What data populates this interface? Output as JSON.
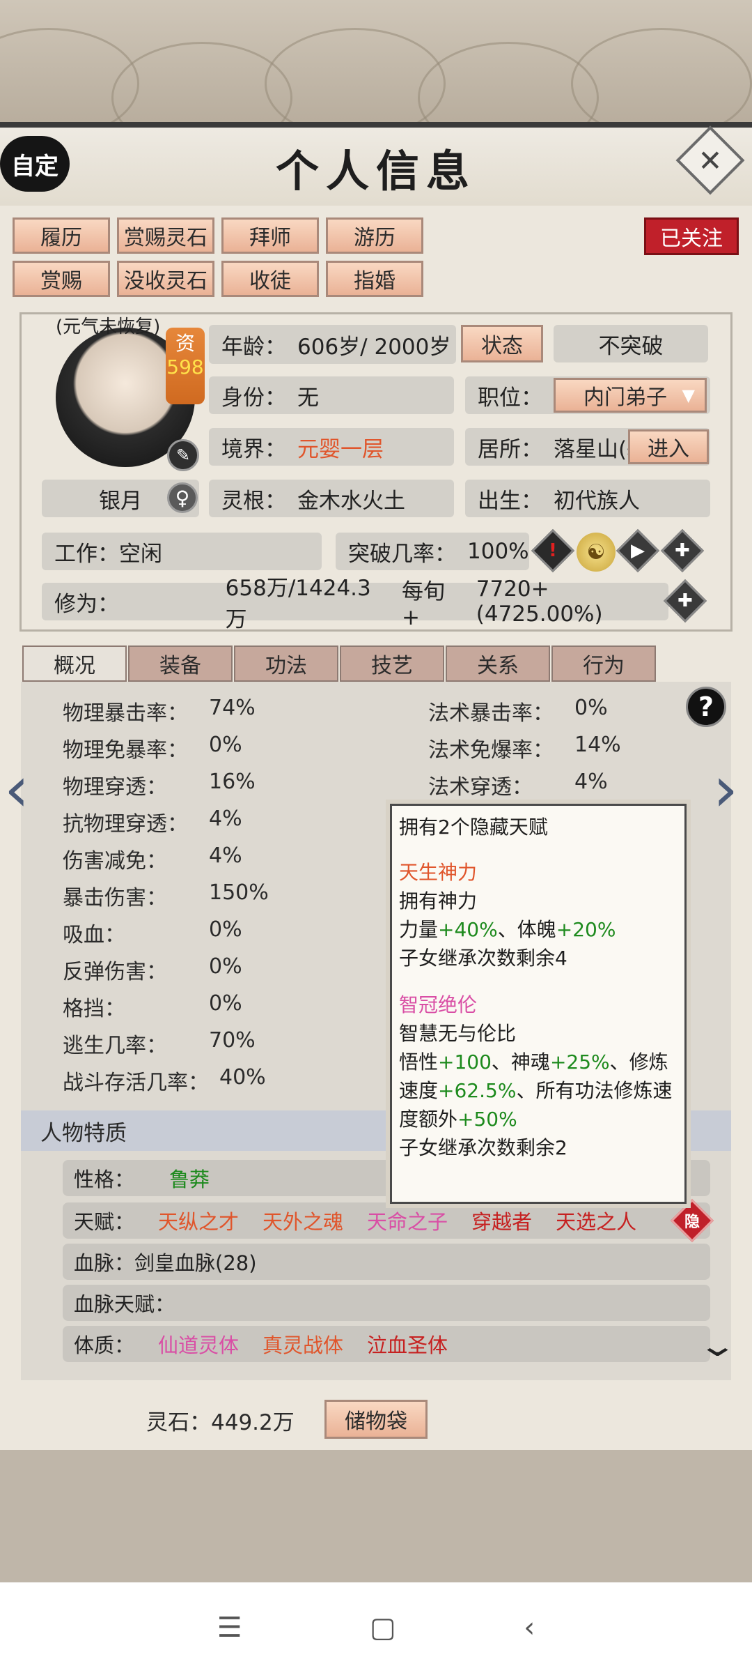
{
  "header": {
    "title": "个人信息",
    "auto_label": "自定",
    "close_icon": "close-icon"
  },
  "actions": {
    "row1": [
      "履历",
      "赏赐灵石",
      "拜师",
      "游历"
    ],
    "row2": [
      "赏赐",
      "没收灵石",
      "收徒",
      "指婚"
    ],
    "follow_badge": "已关注"
  },
  "profile": {
    "status_note": "(元气未恢复)",
    "aptitude_label": "资",
    "aptitude_value": "598",
    "name": "银月",
    "gender_icon": "female-icon",
    "age_label": "年龄：",
    "age_value": "606岁/ 2000岁",
    "state_button": "状态",
    "breakthrough_mode": "不突破",
    "identity_label": "身份：",
    "identity_value": "无",
    "position_label": "职位：",
    "position_value": "内门弟子",
    "realm_label": "境界：",
    "realm_value": "元婴一层",
    "residence_label": "居所：",
    "residence_value": "落星山(基",
    "enter_button": "进入",
    "root_label": "灵根：",
    "root_value": "金木水火土",
    "birth_label": "出生：",
    "birth_value": "初代族人",
    "work_label": "工作：",
    "work_value": "空闲",
    "breakthrough_label": "突破几率：",
    "breakthrough_value": "100%",
    "cultivation_label": "修为：",
    "cultivation_value": "658万/1424.3万",
    "per_turn_label": "每旬+",
    "per_turn_value": "7720+(4725.00%)"
  },
  "tabs": [
    "概况",
    "装备",
    "功法",
    "技艺",
    "关系",
    "行为"
  ],
  "stats_left": [
    {
      "label": "物理暴击率：",
      "value": "74%"
    },
    {
      "label": "物理免暴率：",
      "value": "0%"
    },
    {
      "label": "物理穿透：",
      "value": "16%"
    },
    {
      "label": "抗物理穿透：",
      "value": "4%"
    },
    {
      "label": "伤害减免：",
      "value": "4%"
    },
    {
      "label": "暴击伤害：",
      "value": "150%"
    },
    {
      "label": "吸血：",
      "value": "0%"
    },
    {
      "label": "反弹伤害：",
      "value": "0%"
    },
    {
      "label": "格挡：",
      "value": "0%"
    },
    {
      "label": "逃生几率：",
      "value": "70%"
    },
    {
      "label": "战斗存活几率：",
      "value": "40%"
    }
  ],
  "stats_right": [
    {
      "label": "法术暴击率：",
      "value": "0%"
    },
    {
      "label": "法术免爆率：",
      "value": "14%"
    },
    {
      "label": "法术穿透：",
      "value": "4%"
    }
  ],
  "traits": {
    "header": "人物特质",
    "personality_label": "性格：",
    "personality_value": "鲁莽",
    "talent_label": "天赋：",
    "talents": [
      "天纵之才",
      "天外之魂",
      "天命之子",
      "穿越者",
      "天选之人"
    ],
    "hidden_label": "隐",
    "bloodline_label": "血脉：",
    "bloodline_value": "剑皇血脉(28)",
    "bloodline_talent_label": "血脉天赋：",
    "physique_label": "体质：",
    "physiques": [
      "仙道灵体",
      "真灵战体",
      "泣血圣体"
    ]
  },
  "tooltip": {
    "title": "拥有2个隐藏天赋",
    "t1_name": "天生神力",
    "t1_desc": "拥有神力",
    "t1_l1a": "力量",
    "t1_l1b": "+40%",
    "t1_l1c": "、体魄",
    "t1_l1d": "+20%",
    "t1_inherit": "子女继承次数剩余4",
    "t2_name": "智冠绝伦",
    "t2_desc": "智慧无与伦比",
    "t2_a": "悟性",
    "t2_b": "+100",
    "t2_c": "、神魂",
    "t2_d": "+25%",
    "t2_e": "、修炼速度",
    "t2_f": "+62.5%",
    "t2_g": "、所有功法修炼速度额外",
    "t2_h": "+50%",
    "t2_inherit": "子女继承次数剩余2"
  },
  "footer": {
    "spirit_stone_label": "灵石：",
    "spirit_stone_value": "449.2万",
    "bag_button": "储物袋"
  },
  "colors": {
    "accent_red": "#c0202a",
    "realm_orange": "#e0552b",
    "talent_pink": "#d94ea5",
    "positive_green": "#1d8a1d"
  }
}
